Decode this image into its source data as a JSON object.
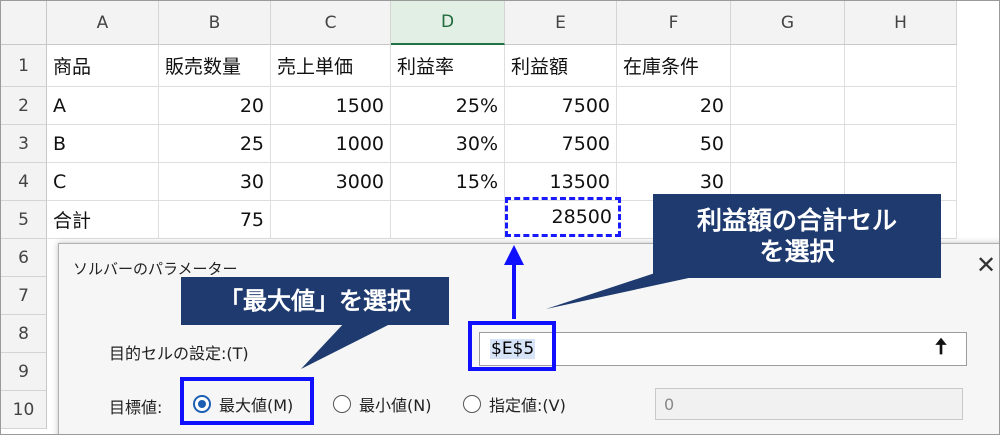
{
  "sheet": {
    "columns": [
      "A",
      "B",
      "C",
      "D",
      "E",
      "F",
      "G",
      "H"
    ],
    "active_column": "D",
    "rows": [
      "1",
      "2",
      "3",
      "4",
      "5",
      "6",
      "7",
      "8",
      "9",
      "10"
    ],
    "headers": [
      "商品",
      "販売数量",
      "売上単価",
      "利益率",
      "利益額",
      "在庫条件"
    ],
    "data": [
      [
        "A",
        "20",
        "1500",
        "25%",
        "7500",
        "20"
      ],
      [
        "B",
        "25",
        "1000",
        "30%",
        "7500",
        "50"
      ],
      [
        "C",
        "30",
        "3000",
        "15%",
        "13500",
        "30"
      ]
    ],
    "total_row": [
      "合計",
      "75",
      "",
      "",
      "28500",
      ""
    ]
  },
  "dialog": {
    "title": "ソルバーのパラメーター",
    "close_glyph": "✕",
    "objective_label": "目的セルの設定:(T)",
    "objective_value": "$E$5",
    "collapse_glyph": "🠅",
    "target_label": "目標値:",
    "options": [
      {
        "label": "最大値(M)",
        "selected": true
      },
      {
        "label": "最小値(N)",
        "selected": false
      },
      {
        "label": "指定値:(V)",
        "selected": false
      }
    ],
    "value_field": "0"
  },
  "annotations": {
    "callout_sum": "利益額の合計セルを選択",
    "callout_sum_line1": "利益額の合計セル",
    "callout_sum_line2": "を選択",
    "callout_max": "「最大値」を選択",
    "highlight_color": "#1010ff",
    "callout_color": "#1e3a6e"
  }
}
